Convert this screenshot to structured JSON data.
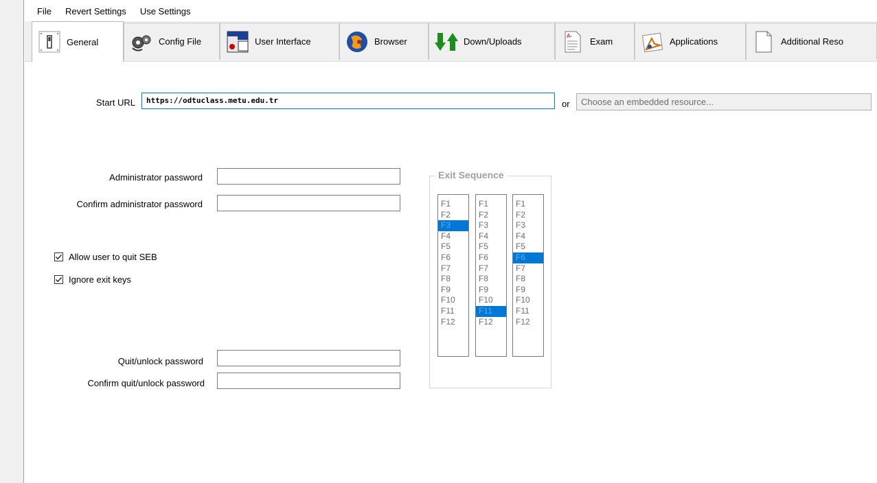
{
  "menu": [
    "File",
    "Revert Settings",
    "Use Settings"
  ],
  "tabs": [
    {
      "label": "General",
      "icon": "switch-icon",
      "active": true
    },
    {
      "label": "Config File",
      "icon": "config-gears-icon"
    },
    {
      "label": "User Interface",
      "icon": "window-file-icon"
    },
    {
      "label": "Browser",
      "icon": "browser-globe-icon"
    },
    {
      "label": "Down/Uploads",
      "icon": "down-up-arrows-icon"
    },
    {
      "label": "Exam",
      "icon": "exam-sheet-icon"
    },
    {
      "label": "Applications",
      "icon": "applications-icon"
    },
    {
      "label": "Additional Reso",
      "icon": "blank-document-icon"
    }
  ],
  "start_url": {
    "label": "Start URL",
    "value": "https://odtuclass.metu.edu.tr"
  },
  "or_label": "or",
  "embedded_resource": {
    "placeholder": "Choose an embedded resource..."
  },
  "admin_password": {
    "label": "Administrator password",
    "value": ""
  },
  "confirm_admin_password": {
    "label": "Confirm administrator password",
    "value": ""
  },
  "allow_quit": {
    "label": "Allow user to quit SEB",
    "checked": true
  },
  "ignore_exit_keys": {
    "label": "Ignore exit keys",
    "checked": true
  },
  "quit_password": {
    "label": "Quit/unlock password",
    "value": ""
  },
  "confirm_quit_password": {
    "label": "Confirm quit/unlock password",
    "value": ""
  },
  "exit_sequence": {
    "title": "Exit Sequence",
    "keys": [
      "F1",
      "F2",
      "F3",
      "F4",
      "F5",
      "F6",
      "F7",
      "F8",
      "F9",
      "F10",
      "F11",
      "F12"
    ],
    "selected": [
      "F3",
      "F11",
      "F6"
    ]
  },
  "colors": {
    "selection": "#0078d7",
    "focus_border": "#0078d7"
  }
}
